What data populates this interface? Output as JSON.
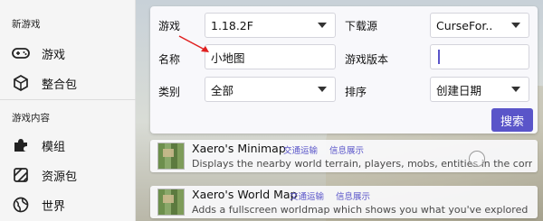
{
  "sidebar": {
    "section1_title": "新游戏",
    "items1": [
      {
        "label": "游戏",
        "icon": "gamepad-icon"
      },
      {
        "label": "整合包",
        "icon": "package-icon"
      }
    ],
    "section2_title": "游戏内容",
    "items2": [
      {
        "label": "模组",
        "icon": "puzzle-icon"
      },
      {
        "label": "资源包",
        "icon": "texture-pack-icon"
      },
      {
        "label": "世界",
        "icon": "globe-icon"
      }
    ]
  },
  "filters": {
    "game_label": "游戏",
    "game_value": "1.18.2F",
    "source_label": "下载源",
    "source_value": "CurseFor..",
    "name_label": "名称",
    "name_value": "小地图",
    "version_label": "游戏版本",
    "version_value": "",
    "category_label": "类别",
    "category_value": "全部",
    "sort_label": "排序",
    "sort_value": "创建日期",
    "search_button": "搜索"
  },
  "results": [
    {
      "title": "Xaero's Minimap",
      "tags": [
        "交通运输",
        "信息展示"
      ],
      "description": "Displays the nearby world terrain, players, mobs, entities in the corner of you..."
    },
    {
      "title": "Xaero's World Map",
      "tags": [
        "交通运输",
        "信息展示"
      ],
      "description": "Adds a fullscreen worldmap which shows you what you've explored"
    }
  ],
  "colors": {
    "accent": "#5a55c9",
    "annotation": "#e02020"
  }
}
